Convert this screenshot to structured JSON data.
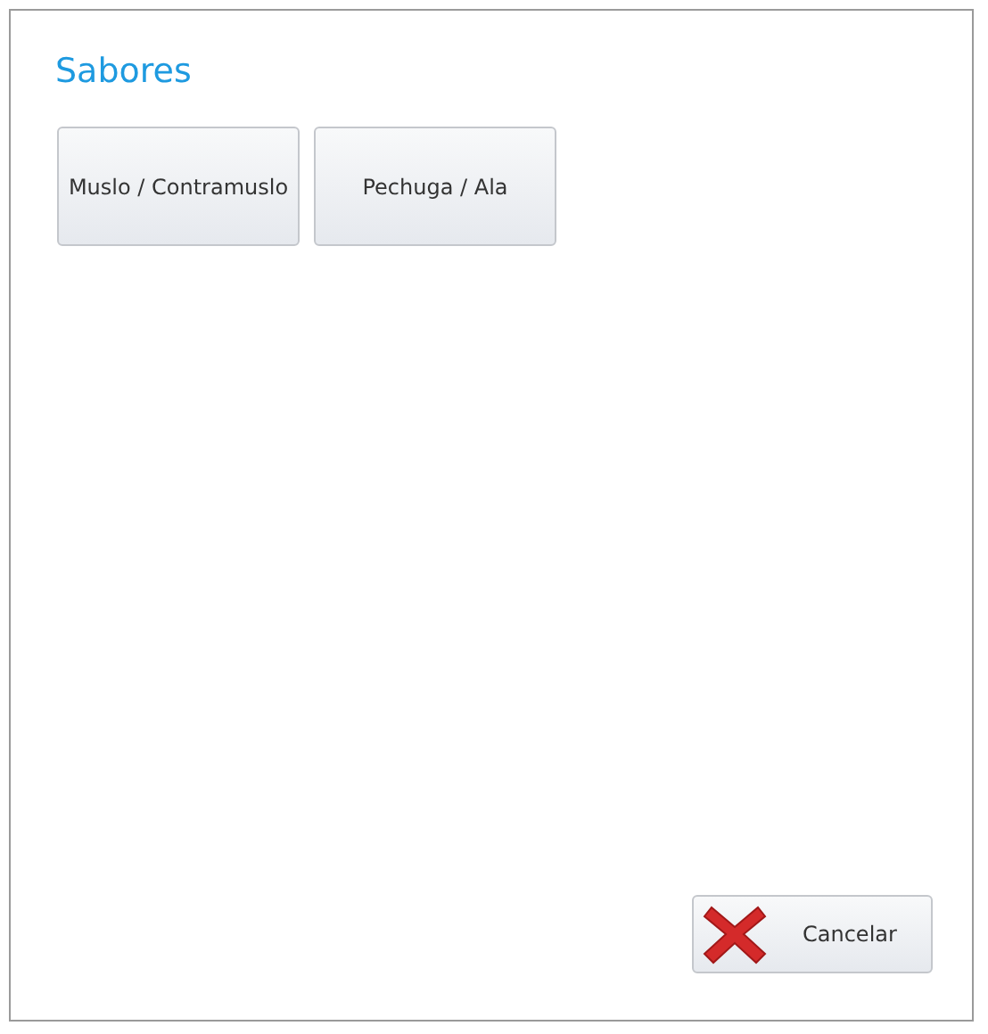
{
  "title": "Sabores",
  "options": [
    {
      "label": "Muslo / Contramuslo"
    },
    {
      "label": "Pechuga / Ala"
    }
  ],
  "cancel_button": {
    "label": "Cancelar"
  }
}
